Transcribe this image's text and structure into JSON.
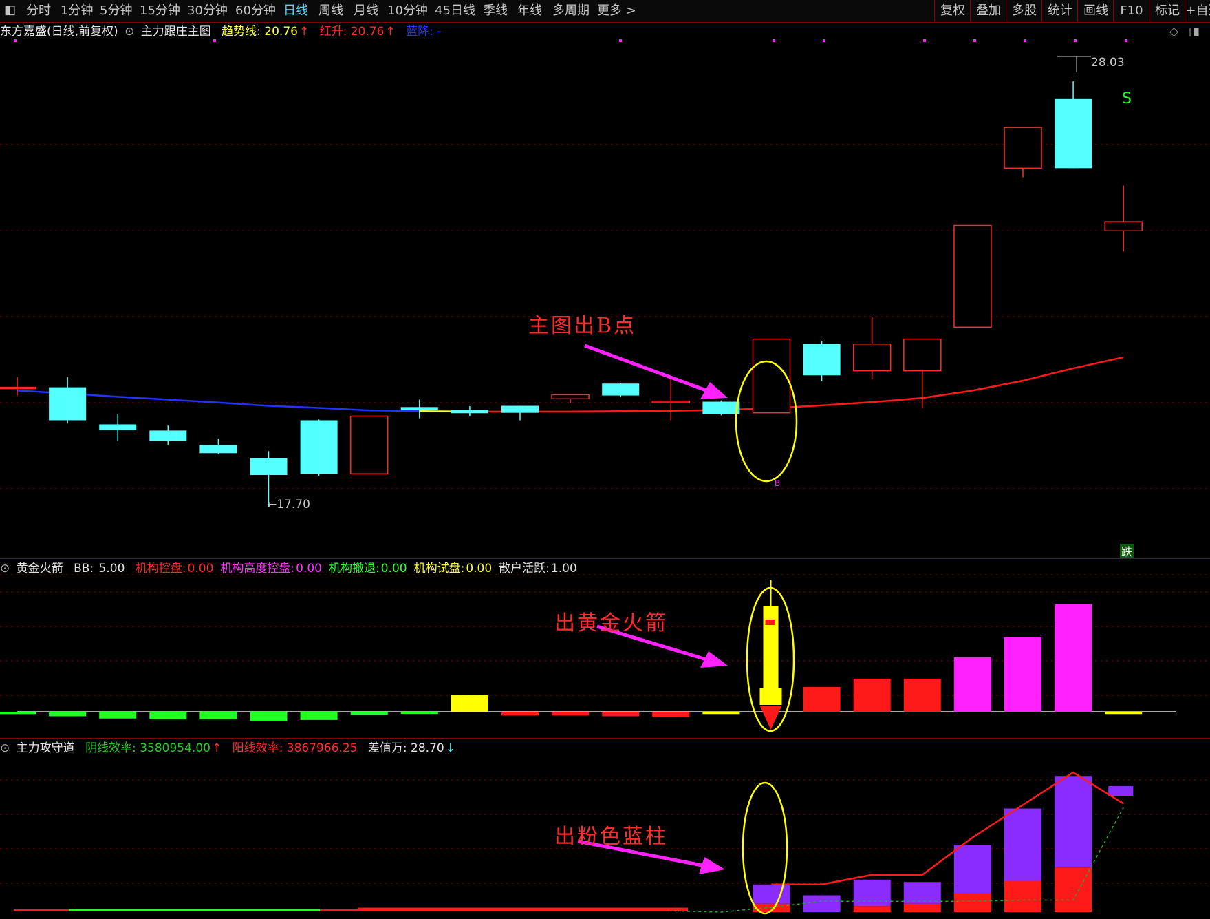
{
  "toolbar": {
    "periods": [
      "分时",
      "1分钟",
      "5分钟",
      "15分钟",
      "30分钟",
      "60分钟",
      "日线",
      "周线",
      "月线",
      "10分钟",
      "45日线",
      "季线",
      "年线",
      "多周期",
      "更多 >"
    ],
    "active_period": "日线",
    "right_buttons": [
      "复权",
      "叠加",
      "多股",
      "统计",
      "画线",
      "F10",
      "标记",
      "+自选"
    ]
  },
  "main_panel": {
    "stock": "东方嘉盛(日线,前复权)",
    "indicator": "主力跟庄主图",
    "trend_label": "趋势线:",
    "trend_value": "20.76",
    "red_label": "红升:",
    "red_value": "20.76",
    "blue_label": "蓝降:",
    "blue_value": "-",
    "high_price_label": "28.03",
    "low_price_label": "←17.70",
    "sell_marker": "S",
    "buy_marker": "B",
    "fall_label": "跌",
    "annotation": "主图出B点"
  },
  "sub_panel_1": {
    "name": "黄金火箭",
    "bb_label": "BB:",
    "bb_value": "5.00",
    "items": [
      {
        "label": "机构控盘:",
        "value": "0.00",
        "color": "#ff2a2a"
      },
      {
        "label": "机构高度控盘:",
        "value": "0.00",
        "color": "#ff33ff"
      },
      {
        "label": "机构撤退:",
        "value": "0.00",
        "color": "#33ff33"
      },
      {
        "label": "机构试盘:",
        "value": "0.00",
        "color": "#ffff33"
      },
      {
        "label": "散户活跃:",
        "value": "1.00",
        "color": "#e0e0e0"
      }
    ],
    "annotation": "出黄金火箭"
  },
  "sub_panel_2": {
    "name": "主力攻守道",
    "yin_label": "阴线效率:",
    "yin_value": "3580954.00",
    "yang_label": "阳线效率:",
    "yang_value": "3867966.25",
    "diff_label": "差值万:",
    "diff_value": "28.70",
    "annotation": "出粉色蓝柱"
  },
  "colors": {
    "up_candle": "#ff2a2a",
    "down_candle": "#54ffff",
    "trend_red": "#ff1a1a",
    "trend_blue": "#2233ff",
    "trend_yellow": "#ffff33",
    "magenta": "#ff22ff",
    "purple": "#8a2cff",
    "yellow": "#ffff00",
    "green": "#22ff22",
    "grid": "#7a0000"
  },
  "candles": [
    {
      "o": 20.6,
      "c": 20.6,
      "h": 20.85,
      "l": 20.4
    },
    {
      "o": 20.6,
      "c": 19.8,
      "h": 20.85,
      "l": 19.72
    },
    {
      "o": 19.7,
      "c": 19.56,
      "h": 19.95,
      "l": 19.3
    },
    {
      "o": 19.55,
      "c": 19.3,
      "h": 19.67,
      "l": 19.2
    },
    {
      "o": 19.2,
      "c": 19.0,
      "h": 19.35,
      "l": 18.98
    },
    {
      "o": 18.88,
      "c": 18.47,
      "h": 19.05,
      "l": 17.7
    },
    {
      "o": 19.8,
      "c": 18.5,
      "h": 19.82,
      "l": 18.45
    },
    {
      "o": 18.5,
      "c": 19.9,
      "h": 19.9,
      "l": 18.5
    },
    {
      "o": 20.12,
      "c": 20.05,
      "h": 20.3,
      "l": 19.85
    },
    {
      "o": 20.05,
      "c": 19.97,
      "h": 20.14,
      "l": 19.9
    },
    {
      "o": 20.15,
      "c": 19.98,
      "h": 20.15,
      "l": 19.8
    },
    {
      "o": 20.32,
      "c": 20.42,
      "h": 20.42,
      "l": 20.22
    },
    {
      "o": 20.69,
      "c": 20.4,
      "h": 20.71,
      "l": 20.37
    },
    {
      "o": 20.24,
      "c": 20.26,
      "h": 20.85,
      "l": 19.8
    },
    {
      "o": 20.25,
      "c": 19.95,
      "h": 20.28,
      "l": 19.92
    },
    {
      "o": 19.98,
      "c": 21.77,
      "h": 21.77,
      "l": 19.98
    },
    {
      "o": 21.65,
      "c": 20.89,
      "h": 21.73,
      "l": 20.75
    },
    {
      "o": 21.0,
      "c": 21.65,
      "h": 22.3,
      "l": 20.8
    },
    {
      "o": 21.0,
      "c": 21.77,
      "h": 21.77,
      "l": 20.1
    },
    {
      "o": 22.06,
      "c": 24.53,
      "h": 24.53,
      "l": 22.06
    },
    {
      "o": 25.92,
      "c": 26.91,
      "h": 26.91,
      "l": 25.7
    },
    {
      "o": 27.6,
      "c": 25.92,
      "h": 28.03,
      "l": 25.92
    },
    {
      "o": 24.4,
      "c": 24.62,
      "h": 25.5,
      "l": 23.9
    }
  ],
  "trend": [
    20.52,
    20.45,
    20.37,
    20.3,
    20.23,
    20.15,
    20.1,
    20.04,
    20.02,
    20.01,
    20.01,
    20.01,
    20.02,
    20.03,
    20.05,
    20.09,
    20.16,
    20.24,
    20.34,
    20.52,
    20.76,
    21.06,
    21.33
  ],
  "trend_colors": [
    "blue",
    "blue",
    "blue",
    "blue",
    "blue",
    "blue",
    "blue",
    "blue",
    "yellow",
    "red",
    "red",
    "red",
    "red",
    "red",
    "red",
    "red",
    "red",
    "red",
    "red",
    "red",
    "red",
    "red",
    "red"
  ],
  "bars1": [
    -0.3,
    -0.6,
    -0.9,
    -1.0,
    -1.0,
    -1.2,
    -1.1,
    -0.4,
    -0.15,
    1.0,
    -0.5,
    -0.5,
    -0.6,
    -0.7,
    -0.3,
    1.0,
    1.5,
    2.0,
    2.0,
    3.3,
    4.5,
    6.5,
    -0.3
  ],
  "bars1_colors": [
    "green",
    "green",
    "green",
    "green",
    "green",
    "green",
    "green",
    "green",
    "green",
    "yellow",
    "red",
    "red",
    "red",
    "red",
    "yellow",
    "red",
    "red",
    "red",
    "red",
    "magenta",
    "magenta",
    "magenta",
    "yellow"
  ],
  "bars2_red": [
    0,
    0,
    0,
    0,
    0,
    0,
    0,
    0,
    0,
    0,
    0,
    0,
    0,
    0,
    0,
    0.7,
    0,
    0.5,
    0.7,
    1.6,
    2.6,
    3.7,
    0
  ],
  "bars2_purple": [
    0,
    0,
    0,
    0,
    0,
    0,
    0,
    0,
    0,
    0,
    0,
    0,
    0,
    0,
    0,
    1.6,
    1.4,
    2.2,
    1.8,
    4.0,
    6.0,
    7.6,
    0.6
  ],
  "bars2_line": [
    0,
    0,
    0,
    0,
    0,
    0,
    0,
    0,
    0,
    0,
    0,
    0,
    0,
    0,
    0,
    2.3,
    2.3,
    3.1,
    3.1,
    6.2,
    8.9,
    11.6,
    9.0
  ],
  "bars2_low": [
    0,
    0.1,
    0.15,
    0.15,
    0.15,
    0.15,
    0.1,
    0.1,
    0.15,
    0.15,
    0.15,
    0.2,
    0.2,
    0.1,
    0,
    0.4,
    0.9,
    0.9,
    0.9,
    0.9,
    1.0,
    1.0,
    8.7
  ]
}
